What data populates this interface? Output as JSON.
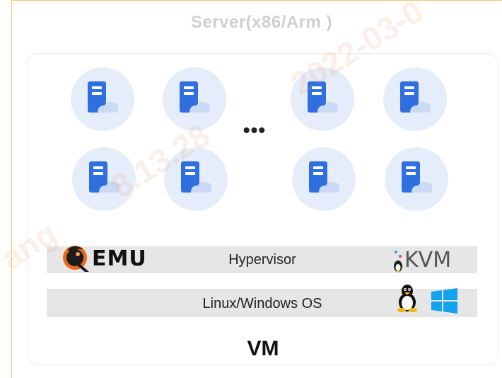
{
  "server": {
    "title": "Server(x86/Arm )"
  },
  "vm_grid": {
    "ellipsis": "•••",
    "icons": [
      "vm-server-icon",
      "vm-server-icon",
      "vm-server-icon",
      "vm-server-icon",
      "vm-server-icon",
      "vm-server-icon",
      "vm-server-icon",
      "vm-server-icon"
    ]
  },
  "hypervisor": {
    "label": "Hypervisor",
    "qemu_text": "EMU",
    "kvm_text": "KVM"
  },
  "os": {
    "label": "Linux/Windows OS"
  },
  "vm": {
    "label": "VM"
  },
  "watermark": {
    "text_1": "2022-03-0",
    "text_2": "8.13.28",
    "text_3": "ang"
  },
  "colors": {
    "accent_blue": "#2f6fe0",
    "icon_bg": "#e6edfa",
    "cloud": "#c9d9f6",
    "bar_bg": "#e6e6e6",
    "frame": "#f3c96a"
  }
}
